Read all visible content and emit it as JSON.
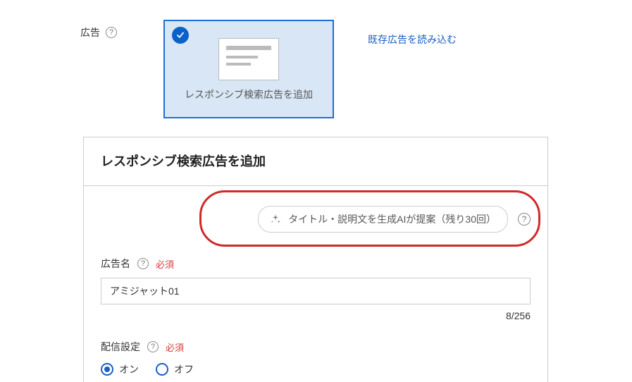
{
  "sidebar": {
    "section_label": "広告"
  },
  "ad_card": {
    "label": "レスポンシブ検索広告を追加"
  },
  "links": {
    "load_existing": "既存広告を読み込む"
  },
  "panel": {
    "title": "レスポンシブ検索広告を追加"
  },
  "ai": {
    "button_label": "タイトル・説明文を生成AIが提案（残り30回）"
  },
  "form": {
    "ad_name": {
      "label": "広告名",
      "required": "必須",
      "value": "アミジャット01",
      "counter": "8/256"
    },
    "delivery": {
      "label": "配信設定",
      "required": "必須",
      "on": "オン",
      "off": "オフ"
    }
  }
}
